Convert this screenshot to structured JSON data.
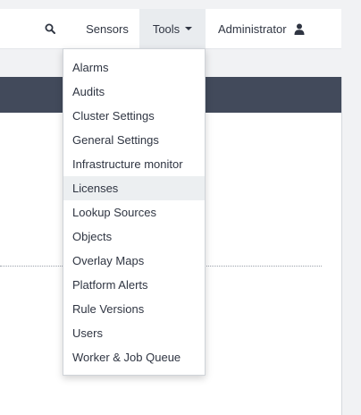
{
  "navbar": {
    "sensors_label": "Sensors",
    "tools_label": "Tools",
    "admin_label": "Administrator",
    "icons": {
      "search": "search-icon",
      "caret": "caret-down-icon",
      "user": "user-icon"
    }
  },
  "tools_menu": {
    "items": [
      {
        "label": "Alarms"
      },
      {
        "label": "Audits"
      },
      {
        "label": "Cluster Settings"
      },
      {
        "label": "General Settings"
      },
      {
        "label": "Infrastructure monitor"
      },
      {
        "label": "Licenses"
      },
      {
        "label": "Lookup Sources"
      },
      {
        "label": "Objects"
      },
      {
        "label": "Overlay Maps"
      },
      {
        "label": "Platform Alerts"
      },
      {
        "label": "Rule Versions"
      },
      {
        "label": "Users"
      },
      {
        "label": "Worker & Job Queue"
      }
    ],
    "highlighted_item": "Licenses"
  },
  "colors": {
    "panel_header": "#424a5b",
    "active_nav_bg": "#e9ecef",
    "menu_highlight": "#eceff1"
  }
}
